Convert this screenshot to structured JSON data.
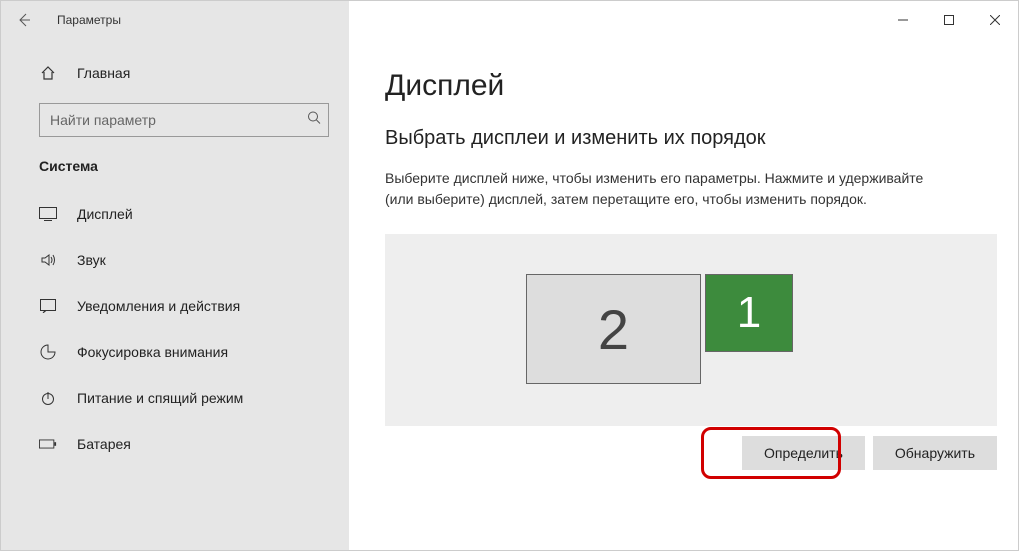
{
  "window": {
    "title": "Параметры"
  },
  "sidebar": {
    "home_label": "Главная",
    "search_placeholder": "Найти параметр",
    "category": "Система",
    "items": [
      {
        "label": "Дисплей"
      },
      {
        "label": "Звук"
      },
      {
        "label": "Уведомления и действия"
      },
      {
        "label": "Фокусировка внимания"
      },
      {
        "label": "Питание и спящий режим"
      },
      {
        "label": "Батарея"
      }
    ]
  },
  "content": {
    "heading": "Дисплей",
    "subheading": "Выбрать дисплеи и изменить их порядок",
    "description": "Выберите дисплей ниже, чтобы изменить его параметры. Нажмите и удерживайте (или выберите) дисплей, затем перетащите его, чтобы изменить порядок.",
    "monitor_2": "2",
    "monitor_1": "1",
    "identify_btn": "Определить",
    "detect_btn": "Обнаружить"
  }
}
